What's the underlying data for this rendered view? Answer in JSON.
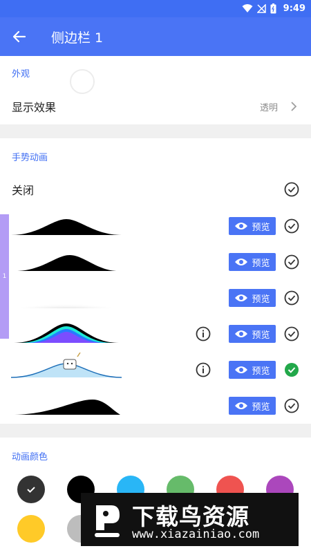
{
  "status_bar": {
    "time": "9:49"
  },
  "app_bar": {
    "title": "侧边栏 1"
  },
  "appearance": {
    "section_title": "外观",
    "display_effect_label": "显示效果",
    "display_effect_value": "透明"
  },
  "gesture_animation": {
    "section_title": "手势动画",
    "off_label": "关闭",
    "preview_label": "预览",
    "side_handle_label": "1",
    "selected_index": 5
  },
  "animation_color": {
    "section_title": "动画颜色",
    "swatches": [
      "#333333",
      "#000000",
      "#29b6f6",
      "#66bb6a",
      "#ef5350",
      "#ab47bc",
      "#ffca28",
      "#bdbdbd"
    ]
  },
  "watermark": {
    "main": "下载鸟资源",
    "url": "www.xiazainiao.com"
  },
  "colors": {
    "primary": "#4a74f5",
    "accent_text": "#3f6ef3",
    "selected_check": "#22a84a"
  }
}
